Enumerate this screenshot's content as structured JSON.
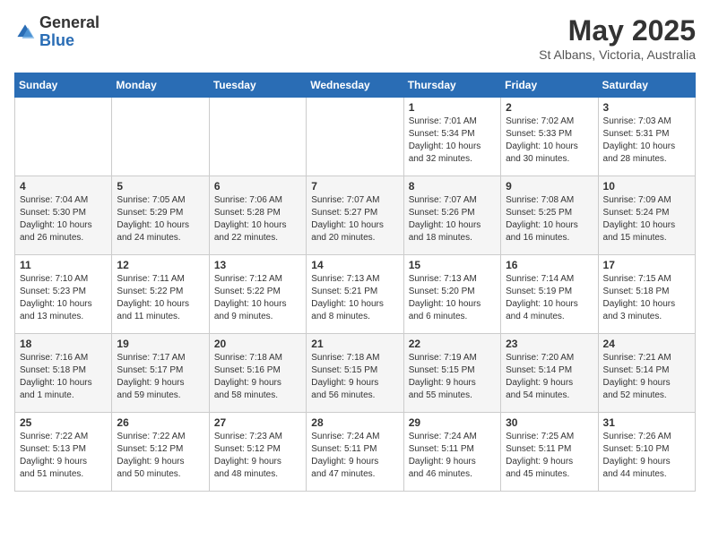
{
  "header": {
    "logo_general": "General",
    "logo_blue": "Blue",
    "month_title": "May 2025",
    "location": "St Albans, Victoria, Australia"
  },
  "days_of_week": [
    "Sunday",
    "Monday",
    "Tuesday",
    "Wednesday",
    "Thursday",
    "Friday",
    "Saturday"
  ],
  "weeks": [
    [
      {
        "day": "",
        "info": ""
      },
      {
        "day": "",
        "info": ""
      },
      {
        "day": "",
        "info": ""
      },
      {
        "day": "",
        "info": ""
      },
      {
        "day": "1",
        "info": "Sunrise: 7:01 AM\nSunset: 5:34 PM\nDaylight: 10 hours\nand 32 minutes."
      },
      {
        "day": "2",
        "info": "Sunrise: 7:02 AM\nSunset: 5:33 PM\nDaylight: 10 hours\nand 30 minutes."
      },
      {
        "day": "3",
        "info": "Sunrise: 7:03 AM\nSunset: 5:31 PM\nDaylight: 10 hours\nand 28 minutes."
      }
    ],
    [
      {
        "day": "4",
        "info": "Sunrise: 7:04 AM\nSunset: 5:30 PM\nDaylight: 10 hours\nand 26 minutes."
      },
      {
        "day": "5",
        "info": "Sunrise: 7:05 AM\nSunset: 5:29 PM\nDaylight: 10 hours\nand 24 minutes."
      },
      {
        "day": "6",
        "info": "Sunrise: 7:06 AM\nSunset: 5:28 PM\nDaylight: 10 hours\nand 22 minutes."
      },
      {
        "day": "7",
        "info": "Sunrise: 7:07 AM\nSunset: 5:27 PM\nDaylight: 10 hours\nand 20 minutes."
      },
      {
        "day": "8",
        "info": "Sunrise: 7:07 AM\nSunset: 5:26 PM\nDaylight: 10 hours\nand 18 minutes."
      },
      {
        "day": "9",
        "info": "Sunrise: 7:08 AM\nSunset: 5:25 PM\nDaylight: 10 hours\nand 16 minutes."
      },
      {
        "day": "10",
        "info": "Sunrise: 7:09 AM\nSunset: 5:24 PM\nDaylight: 10 hours\nand 15 minutes."
      }
    ],
    [
      {
        "day": "11",
        "info": "Sunrise: 7:10 AM\nSunset: 5:23 PM\nDaylight: 10 hours\nand 13 minutes."
      },
      {
        "day": "12",
        "info": "Sunrise: 7:11 AM\nSunset: 5:22 PM\nDaylight: 10 hours\nand 11 minutes."
      },
      {
        "day": "13",
        "info": "Sunrise: 7:12 AM\nSunset: 5:22 PM\nDaylight: 10 hours\nand 9 minutes."
      },
      {
        "day": "14",
        "info": "Sunrise: 7:13 AM\nSunset: 5:21 PM\nDaylight: 10 hours\nand 8 minutes."
      },
      {
        "day": "15",
        "info": "Sunrise: 7:13 AM\nSunset: 5:20 PM\nDaylight: 10 hours\nand 6 minutes."
      },
      {
        "day": "16",
        "info": "Sunrise: 7:14 AM\nSunset: 5:19 PM\nDaylight: 10 hours\nand 4 minutes."
      },
      {
        "day": "17",
        "info": "Sunrise: 7:15 AM\nSunset: 5:18 PM\nDaylight: 10 hours\nand 3 minutes."
      }
    ],
    [
      {
        "day": "18",
        "info": "Sunrise: 7:16 AM\nSunset: 5:18 PM\nDaylight: 10 hours\nand 1 minute."
      },
      {
        "day": "19",
        "info": "Sunrise: 7:17 AM\nSunset: 5:17 PM\nDaylight: 9 hours\nand 59 minutes."
      },
      {
        "day": "20",
        "info": "Sunrise: 7:18 AM\nSunset: 5:16 PM\nDaylight: 9 hours\nand 58 minutes."
      },
      {
        "day": "21",
        "info": "Sunrise: 7:18 AM\nSunset: 5:15 PM\nDaylight: 9 hours\nand 56 minutes."
      },
      {
        "day": "22",
        "info": "Sunrise: 7:19 AM\nSunset: 5:15 PM\nDaylight: 9 hours\nand 55 minutes."
      },
      {
        "day": "23",
        "info": "Sunrise: 7:20 AM\nSunset: 5:14 PM\nDaylight: 9 hours\nand 54 minutes."
      },
      {
        "day": "24",
        "info": "Sunrise: 7:21 AM\nSunset: 5:14 PM\nDaylight: 9 hours\nand 52 minutes."
      }
    ],
    [
      {
        "day": "25",
        "info": "Sunrise: 7:22 AM\nSunset: 5:13 PM\nDaylight: 9 hours\nand 51 minutes."
      },
      {
        "day": "26",
        "info": "Sunrise: 7:22 AM\nSunset: 5:12 PM\nDaylight: 9 hours\nand 50 minutes."
      },
      {
        "day": "27",
        "info": "Sunrise: 7:23 AM\nSunset: 5:12 PM\nDaylight: 9 hours\nand 48 minutes."
      },
      {
        "day": "28",
        "info": "Sunrise: 7:24 AM\nSunset: 5:11 PM\nDaylight: 9 hours\nand 47 minutes."
      },
      {
        "day": "29",
        "info": "Sunrise: 7:24 AM\nSunset: 5:11 PM\nDaylight: 9 hours\nand 46 minutes."
      },
      {
        "day": "30",
        "info": "Sunrise: 7:25 AM\nSunset: 5:11 PM\nDaylight: 9 hours\nand 45 minutes."
      },
      {
        "day": "31",
        "info": "Sunrise: 7:26 AM\nSunset: 5:10 PM\nDaylight: 9 hours\nand 44 minutes."
      }
    ]
  ]
}
